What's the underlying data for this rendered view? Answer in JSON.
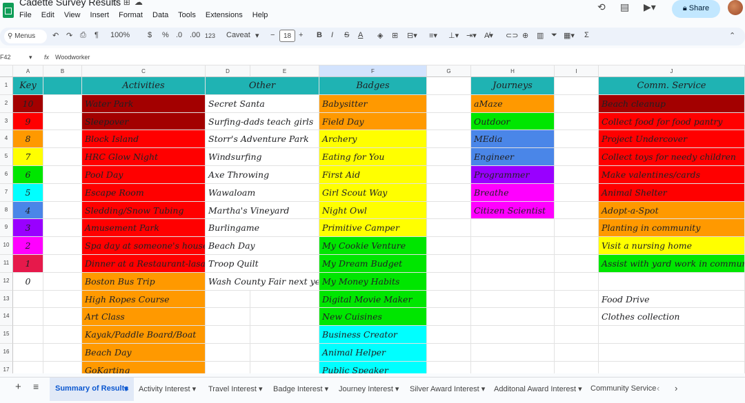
{
  "app": {
    "title": "Cadette Survey Results",
    "menu": [
      "File",
      "Edit",
      "View",
      "Insert",
      "Format",
      "Data",
      "Tools",
      "Extensions",
      "Help"
    ],
    "share_label": "Share"
  },
  "toolbar": {
    "menus_label": "Menus",
    "zoom": "100%",
    "currency": "$",
    "percent": "%",
    "dec_decrease": ".0",
    "dec_increase": ".00",
    "format_123": "123",
    "font": "Caveat",
    "font_size": "18",
    "minus": "−",
    "plus": "+",
    "bold": "B",
    "italic": "I",
    "strike": "S",
    "text_color": "A",
    "sigma": "Σ"
  },
  "formula": {
    "cell_ref": "F42",
    "fx": "fx",
    "value": "Woodworker"
  },
  "columns": [
    "A",
    "B",
    "C",
    "D",
    "E",
    "F",
    "G",
    "H",
    "I",
    "J"
  ],
  "row_numbers": [
    "1",
    "2",
    "3",
    "4",
    "5",
    "6",
    "7",
    "8",
    "9",
    "10",
    "11",
    "12",
    "13",
    "14",
    "15",
    "16",
    "17"
  ],
  "headers": {
    "key": "Key",
    "activities": "Activities",
    "other": "Other",
    "badges": "Badges",
    "journeys": "Journeys",
    "comm_service": "Comm. Service"
  },
  "key_values": [
    "10",
    "9",
    "8",
    "7",
    "6",
    "5",
    "4",
    "3",
    "2",
    "1",
    "0"
  ],
  "activities": [
    "Water Park",
    "Sleepover",
    "Block Island",
    "HRC Glow Night",
    "Pool Day",
    "Escape Room",
    "Sledding/Snow Tubing",
    "Amusement Park",
    "Spa day at someone's house",
    "Dinner at a Restaurant-lasalette",
    "Boston Bus Trip",
    "High Ropes Course",
    "Art Class",
    "Kayak/Paddle Board/Boat",
    "Beach Day",
    "GoKarting"
  ],
  "other": [
    "Secret Santa",
    "Surfing-dads teach girls",
    "Storr's Adventure Park",
    "Windsurfing",
    "Axe Throwing",
    "Wawaloam",
    "Martha's Vineyard",
    "Burlingame",
    "Beach Day",
    "Troop Quilt",
    "Wash County Fair next year"
  ],
  "badges": [
    "Babysitter",
    "Field Day",
    "Archery",
    "Eating for You",
    "First Aid",
    "Girl Scout Way",
    "Night Owl",
    "Primitive Camper",
    "My Cookie Venture",
    "My Dream Budget",
    "My Money Habits",
    "Digital Movie Maker",
    "New Cuisines",
    "Business Creator",
    "Animal Helper",
    "Public Speaker"
  ],
  "journeys": [
    "aMaze",
    "Outdoor",
    "MEdia",
    "Engineer",
    "Programmer",
    "Breathe",
    "Citizen Scientist"
  ],
  "comm_service": [
    "Beach cleanup",
    "Collect food for food pantry",
    "Project Undercover",
    "Collect toys for needy children",
    "Make valentines/cards",
    "Animal Shelter",
    "Adopt-a-Spot",
    "Planting in community",
    "Visit a nursing home",
    "Assist with yard work in community",
    "",
    "Food Drive",
    "Clothes collection"
  ],
  "colors": {
    "header": "#1fb3b3",
    "dark_red": "#a30000",
    "red": "#ff0000",
    "orange": "#ff9900",
    "yellow": "#ffff00",
    "green": "#00e600",
    "cyan": "#00ffff",
    "blue": "#4a86e8",
    "purple": "#9900ff",
    "magenta": "#ff00ff",
    "crimson": "#e6194b"
  },
  "sheets": [
    "Summary of Results",
    "Activity Interest",
    "Travel Interest",
    "Badge Interest",
    "Journey Interest",
    "Silver Award Interest",
    "Additonal Award Interest",
    "Community Service"
  ]
}
